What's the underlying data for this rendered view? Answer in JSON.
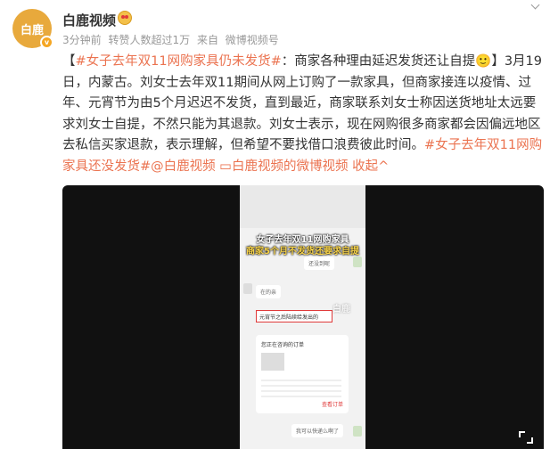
{
  "post": {
    "avatar_text": "白鹿",
    "author": "白鹿视频",
    "meta": {
      "time": "3分钟前",
      "reposts": "转赞人数超过1万",
      "from_label": "来自",
      "source": "微博视频号"
    },
    "text": {
      "open_bracket": "【",
      "topic1": "#女子去年双11网购家具仍未发货#",
      "headline": "：商家各种理由延迟发货还让自提",
      "headline_emoji": "🙂",
      "close_bracket": "】",
      "body": "3月19日，内蒙古。刘女士去年双11期间从网上订购了一款家具，但商家接连以疫情、过年、元宵节为由5个月迟迟不发货，直到最近，商家联系刘女士称因送货地址太远要求刘女士自提，不然只能为其退款。刘女士表示，现在网购很多商家都会因偏远地区去私信买家退款，表示理解，但希望不要找借口浪费彼此时间。",
      "topic2": "#女子去年双11网购家具还没发货#",
      "mention": "@白鹿视频",
      "video_link": "白鹿视频的微博视频",
      "collapse": "收起"
    }
  },
  "video": {
    "title_line1": "女子去年双11网购家具",
    "title_line2": "商家5个月不发货还要求自提",
    "chat_right_1": "还没到呢",
    "chat_left_1": "在的亲",
    "chat_highlight": "元宵节之后陆续给发出的",
    "watermark": "白鹿",
    "order_title": "您正在咨询的订单",
    "order_button": "查看订单",
    "chat_right_2": "我可以快递么啊了"
  },
  "colors": {
    "link": "#eb7350",
    "avatar_bg": "#e8a93c",
    "video_bg": "#111111",
    "highlight_box": "#e03a3a"
  }
}
